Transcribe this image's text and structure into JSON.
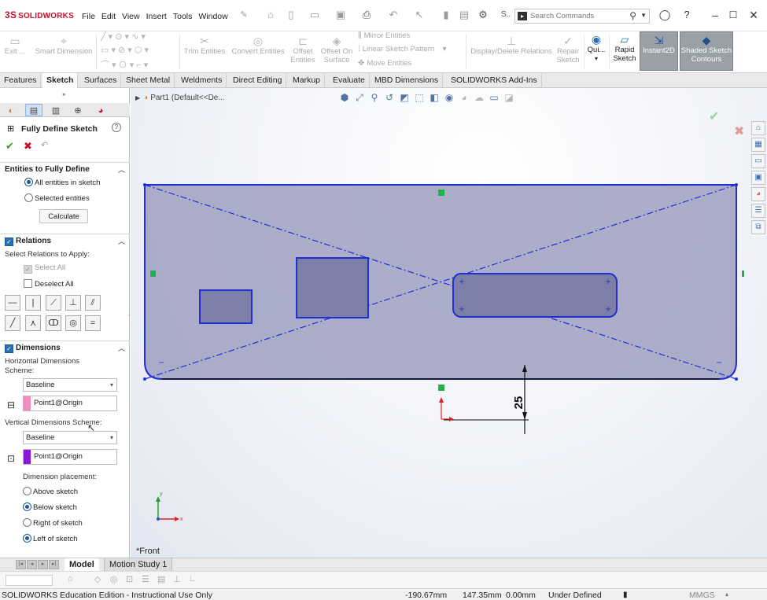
{
  "app": {
    "brand_prefix": "3S",
    "brand": "SOLIDWORKS",
    "menu": [
      "File",
      "Edit",
      "View",
      "Insert",
      "Tools",
      "Window"
    ],
    "pin_icon": "pin-icon",
    "search_placeholder": "Search Commands",
    "toolbar_label_s": "S.."
  },
  "command_manager": {
    "exit_sketch": "Exit ...",
    "smart_dimension": "Smart Dimension",
    "trim_entities": "Trim Entities",
    "convert_entities": "Convert Entities",
    "offset_entities": [
      "Offset",
      "Entities"
    ],
    "offset_on_surface": [
      "Offset On",
      "Surface"
    ],
    "mirror_entities": "Mirror Entities",
    "linear_sketch_pattern": "Linear Sketch Pattern",
    "move_entities": "Move Entities",
    "display_delete_relations": "Display/Delete Relations",
    "repair_sketch": [
      "Repair",
      "Sketch"
    ],
    "quick_snaps": "Qui...",
    "rapid_sketch": [
      "Rapid",
      "Sketch"
    ],
    "instant2d": "Instant2D",
    "shaded_sketch_contours": [
      "Shaded Sketch",
      "Contours"
    ]
  },
  "tabs": [
    "Features",
    "Sketch",
    "Surfaces",
    "Sheet Metal",
    "Weldments",
    "Direct Editing",
    "Markup",
    "Evaluate",
    "MBD Dimensions",
    "SOLIDWORKS Add-Ins"
  ],
  "active_tab": "Sketch",
  "panel": {
    "title": "Fully Define Sketch",
    "entities_group": {
      "title": "Entities to Fully Define",
      "all_entities": "All entities in sketch",
      "selected_entities": "Selected entities",
      "calculate": "Calculate",
      "selected_option": "All entities in sketch"
    },
    "relations_group": {
      "title": "Relations",
      "checked": true,
      "prompt": "Select Relations to Apply:",
      "select_all": "Select All",
      "deselect_all": "Deselect All"
    },
    "dimensions_group": {
      "title": "Dimensions",
      "checked": true,
      "horizontal_label": [
        "Horizontal Dimensions",
        "Scheme:"
      ],
      "horizontal_scheme": "Baseline",
      "horizontal_origin": "Point1@Origin",
      "horizontal_color": "#f28cc0",
      "vertical_label": "Vertical Dimensions Scheme:",
      "vertical_scheme": "Baseline",
      "vertical_origin": "Point1@Origin",
      "vertical_color": "#8a18d6",
      "placement_label": "Dimension placement:",
      "above": "Above sketch",
      "below": "Below sketch",
      "right": "Right of sketch",
      "left": "Left of sketch",
      "selected_vertical_placement": "Below sketch",
      "selected_horizontal_placement": "Left of sketch"
    }
  },
  "viewport": {
    "tree_label": "Part1  (Default<<De...",
    "view_name": "*Front",
    "dimension_value": "25",
    "sketch_color": "#1f2fd1",
    "fill_color": "#9da0c0"
  },
  "bottom_tabs": [
    "Model",
    "Motion Study 1"
  ],
  "status": {
    "edition": "SOLIDWORKS Education Edition - Instructional Use Only",
    "x": "-190.67mm",
    "y": "147.35mm",
    "z": "0.00mm",
    "state": "Under Defined",
    "units": "MMGS"
  }
}
